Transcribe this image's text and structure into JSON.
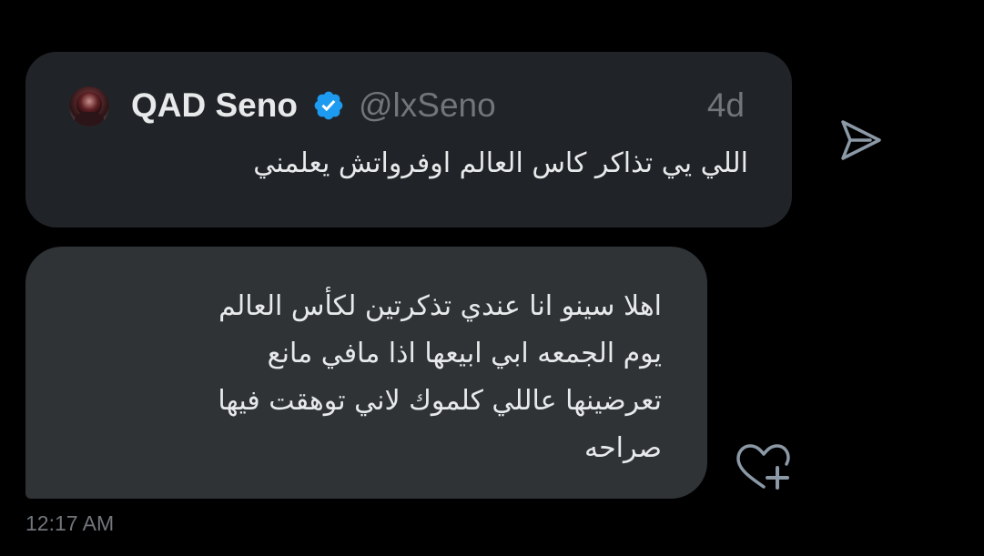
{
  "quoted_post": {
    "author_name": "QAD Seno",
    "author_handle": "@lxSeno",
    "time_ago": "4d",
    "text": "اللي يي تذاكر كاس العالم اوفرواتش يعلمني",
    "verified": true
  },
  "message": {
    "lines": [
      "اهلا سينو انا عندي تذكرتين لكأس العالم",
      "يوم الجمعه ابي ابيعها اذا مافي مانع",
      "تعرضينها عاللي كلموك لاني توهقت فيها",
      "صراحه"
    ]
  },
  "timestamp": "12:17 AM",
  "icons": {
    "avatar": "profile-photo",
    "verified": "verified-badge-icon",
    "share": "send-icon",
    "react": "heart-plus-icon"
  },
  "colors": {
    "background": "#000000",
    "quoted_card": "#202327",
    "message_bubble": "#2f3336",
    "primary_text": "#e7e9ea",
    "secondary_text": "#71767b",
    "verified_blue": "#1d9bf0"
  }
}
